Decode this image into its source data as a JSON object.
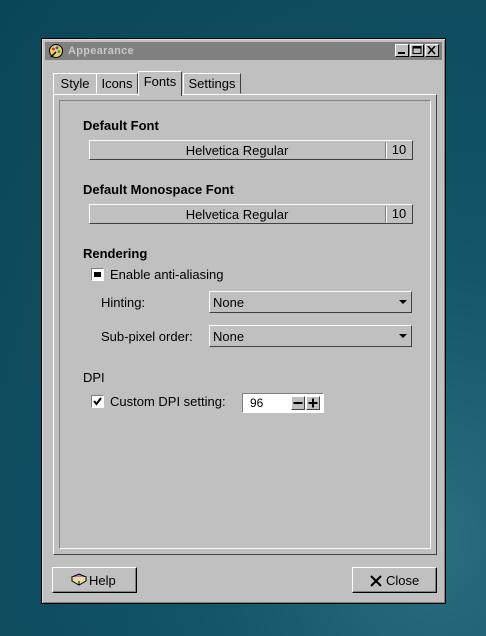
{
  "window": {
    "title": "Appearance",
    "controls": [
      "minimize",
      "maximize",
      "close"
    ]
  },
  "tabs": [
    {
      "label": "Style",
      "active": false
    },
    {
      "label": "Icons",
      "active": false
    },
    {
      "label": "Fonts",
      "active": true
    },
    {
      "label": "Settings",
      "active": false
    }
  ],
  "fonts": {
    "default_heading": "Default Font",
    "default_font_name": "Helvetica Regular",
    "default_font_size": "10",
    "mono_heading": "Default Monospace Font",
    "mono_font_name": "Helvetica Regular",
    "mono_font_size": "10"
  },
  "rendering": {
    "heading": "Rendering",
    "antialias_label": "Enable anti-aliasing",
    "antialias_state": "partial",
    "hinting_label": "Hinting:",
    "hinting_value": "None",
    "subpixel_label": "Sub-pixel order:",
    "subpixel_value": "None"
  },
  "dpi": {
    "heading": "DPI",
    "custom_label": "Custom DPI setting:",
    "custom_checked": true,
    "value": "96"
  },
  "buttons": {
    "help": "Help",
    "close": "Close"
  }
}
